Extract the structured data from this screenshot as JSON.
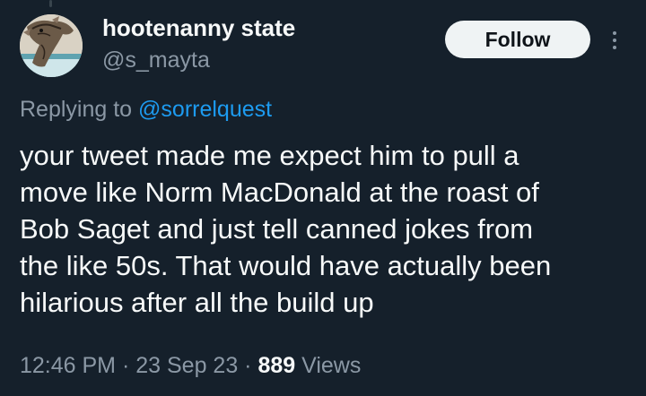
{
  "user": {
    "display_name": "hootenanny state",
    "handle": "@s_mayta"
  },
  "actions": {
    "follow_label": "Follow",
    "more_icon": "more-vertical-icon"
  },
  "reply": {
    "prefix": "Replying to ",
    "mention": "@sorrelquest"
  },
  "tweet": {
    "lines": [
      "your tweet made me expect him to pull a",
      "move like Norm MacDonald at the roast of",
      "Bob Saget and just tell canned jokes from",
      "the like 50s. That would have actually been",
      "hilarious after all the build up"
    ]
  },
  "meta": {
    "time": "12:46 PM",
    "separator": " · ",
    "date": "23 Sep 23",
    "views_count": "889",
    "views_label": " Views"
  },
  "colors": {
    "background": "#15202b",
    "text": "#f7f9f9",
    "secondary": "#8b98a5",
    "link": "#1d9bf0",
    "follow_bg": "#eff3f4"
  }
}
